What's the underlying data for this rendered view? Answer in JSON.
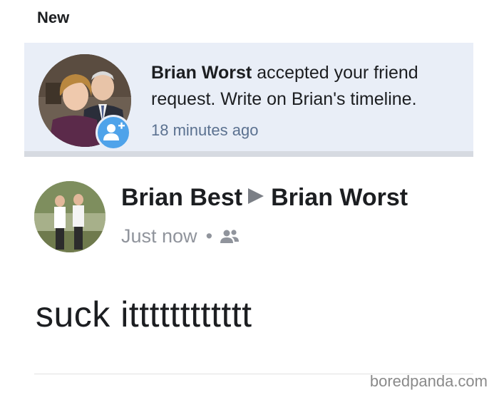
{
  "section": {
    "title": "New"
  },
  "notification": {
    "actor": "Brian Worst",
    "text": "accepted your friend request. Write on Brian's timeline.",
    "time": "18 minutes ago",
    "badge_icon": "add-friend-icon",
    "avatar_alt": "profile photo"
  },
  "post": {
    "author": "Brian Best",
    "target": "Brian Worst",
    "time": "Just now",
    "separator": "•",
    "audience_icon": "friends-icon",
    "body": "suck itttttttttttt"
  },
  "watermark": "boredpanda.com",
  "colors": {
    "notification_bg": "#e9eef7",
    "badge": "#4fa3ea",
    "timestamp": "#5b7190",
    "meta": "#90949c"
  }
}
